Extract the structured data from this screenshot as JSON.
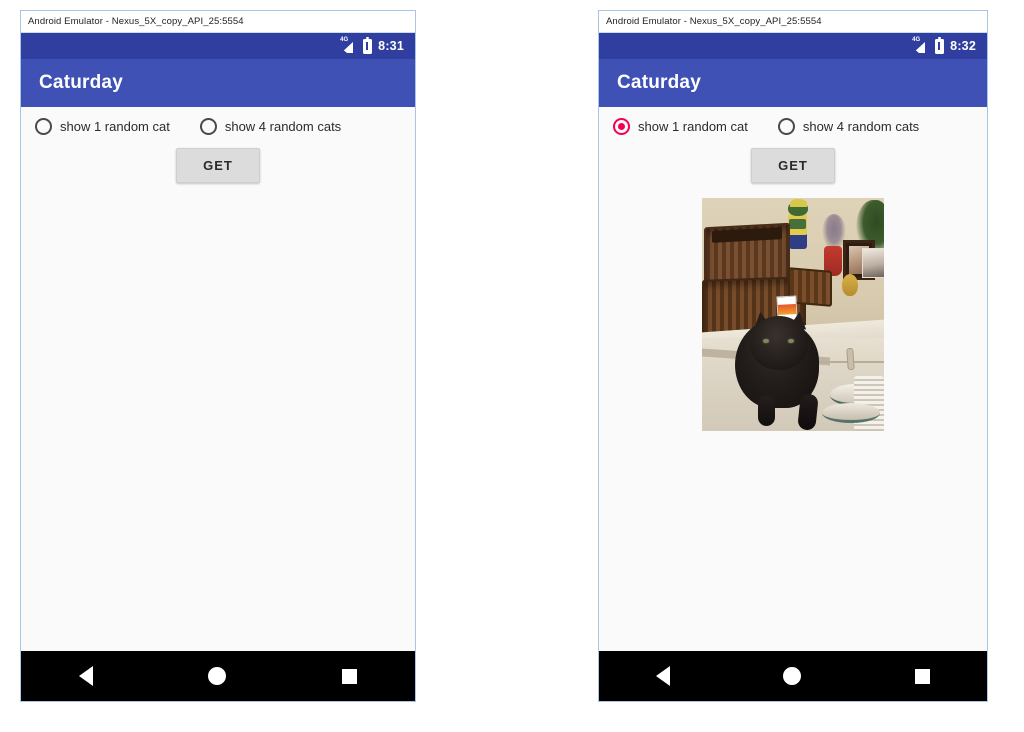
{
  "emulators": [
    {
      "id": "left",
      "window_title": "Android Emulator - Nexus_5X_copy_API_25:5554",
      "status_bar": {
        "network_label": "4G",
        "signal_icon": "signal-bars-icon",
        "battery_icon": "battery-icon",
        "time": "8:31"
      },
      "app_bar": {
        "title": "Caturday"
      },
      "radios": [
        {
          "label": "show 1 random cat",
          "checked": false
        },
        {
          "label": "show 4 random cats",
          "checked": false
        }
      ],
      "get_button": {
        "label": "GET"
      },
      "image_loaded": false,
      "image_caption": "",
      "nav_bar": {
        "back": "back-triangle-icon",
        "home": "home-circle-icon",
        "recents": "recents-square-icon"
      }
    },
    {
      "id": "right",
      "window_title": "Android Emulator - Nexus_5X_copy_API_25:5554",
      "status_bar": {
        "network_label": "4G",
        "signal_icon": "signal-bars-icon",
        "battery_icon": "battery-icon",
        "time": "8:32"
      },
      "app_bar": {
        "title": "Caturday"
      },
      "radios": [
        {
          "label": "show 1 random cat",
          "checked": true
        },
        {
          "label": "show 4 random cats",
          "checked": false
        }
      ],
      "get_button": {
        "label": "GET"
      },
      "image_loaded": true,
      "image_caption": "black cat sitting on a white dresser next to stacked wicker baskets",
      "nav_bar": {
        "back": "back-triangle-icon",
        "home": "home-circle-icon",
        "recents": "recents-square-icon"
      }
    }
  ],
  "colors": {
    "status_bar": "#303F9F",
    "app_bar": "#3F51B5",
    "accent_selected_radio": "#F50057",
    "button_face": "#DCDCDC",
    "nav_bar": "#000000",
    "window_border": "#A9C6E8",
    "screen_background": "#FAFAFA"
  }
}
